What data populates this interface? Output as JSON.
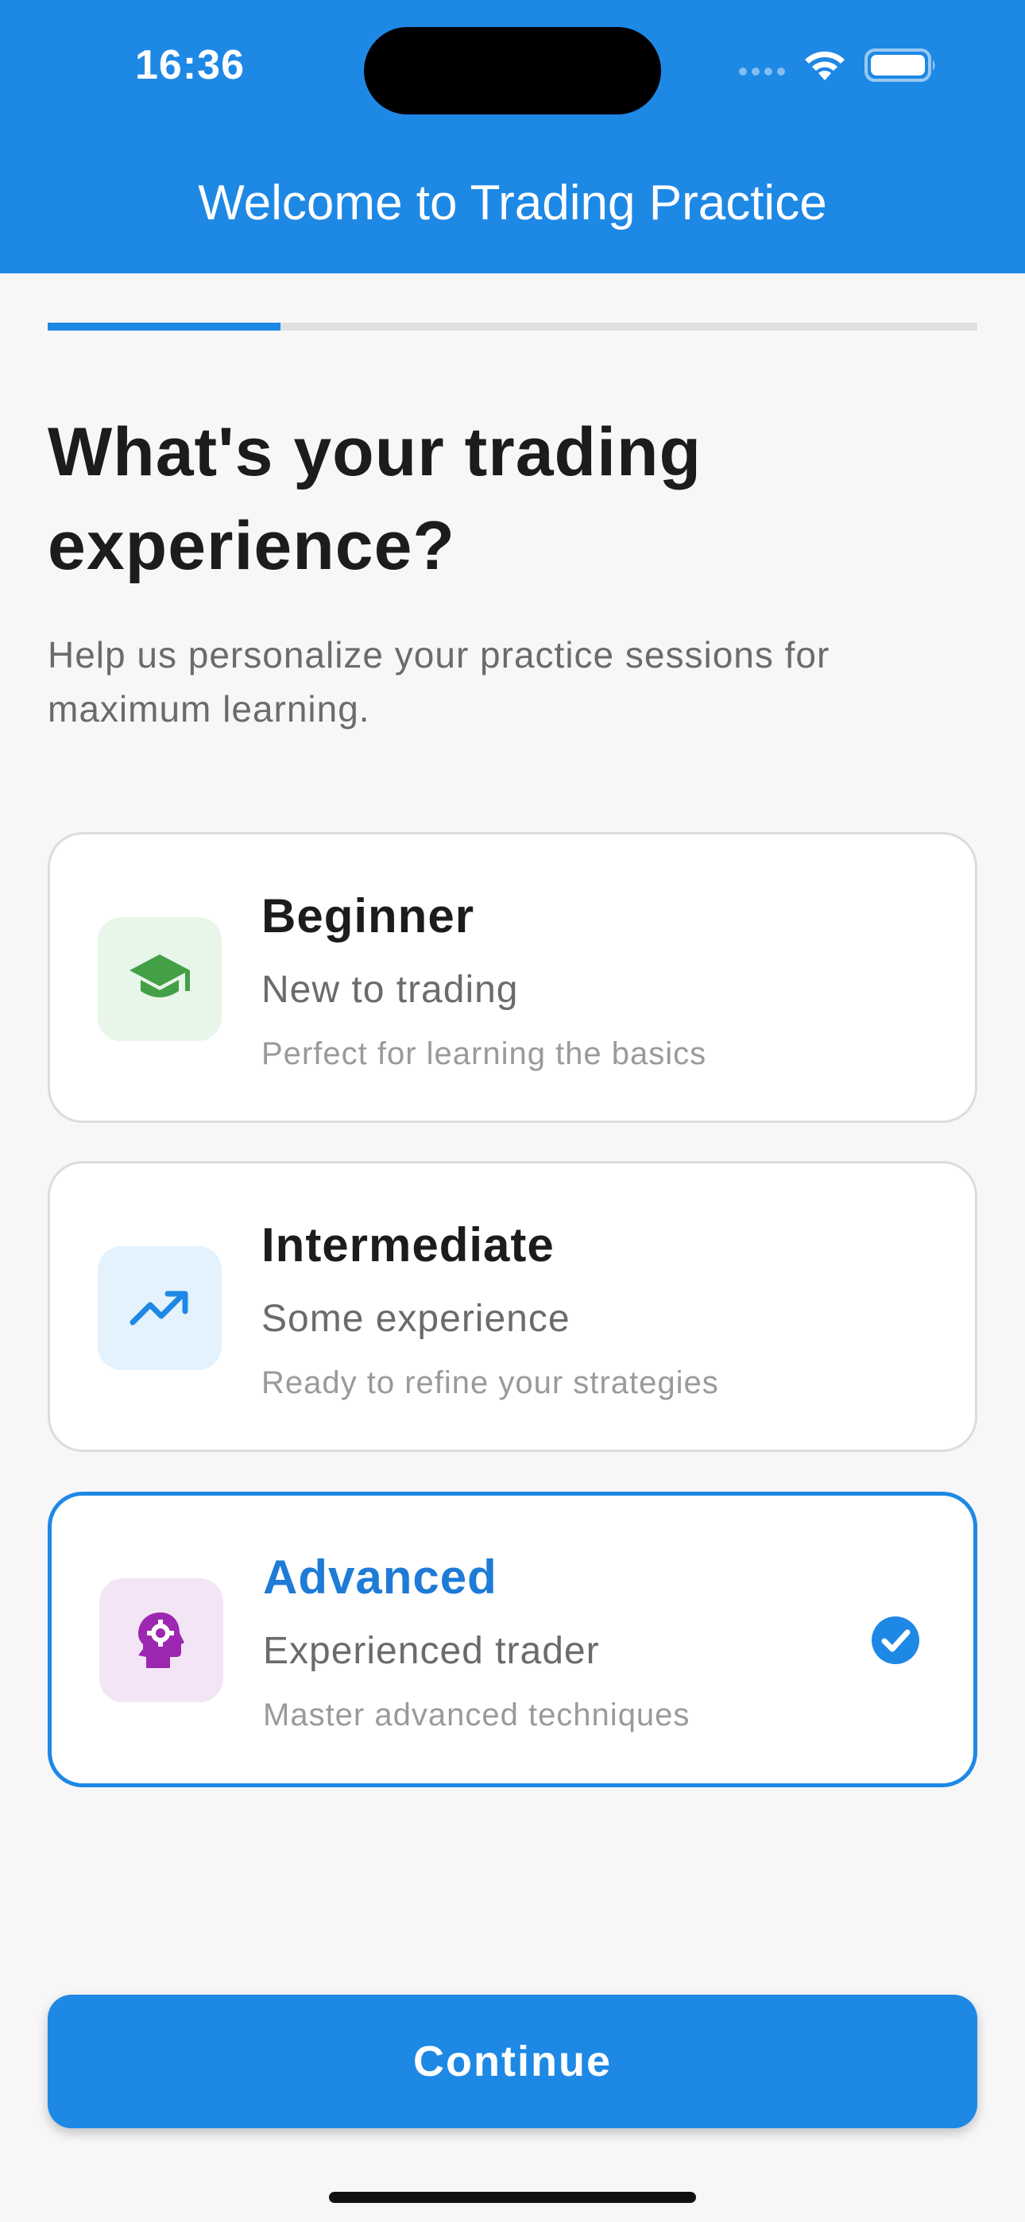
{
  "status_bar": {
    "time": "16:36"
  },
  "header": {
    "title": "Welcome to Trading Practice"
  },
  "progress": {
    "fraction": 0.25
  },
  "question": {
    "title": "What's your trading experience?",
    "subtitle": "Help us personalize your practice sessions for maximum learning."
  },
  "options": [
    {
      "title": "Beginner",
      "subtitle": "New to trading",
      "description": "Perfect for learning the basics",
      "icon": "graduation-cap-icon",
      "icon_color": "#43a047",
      "icon_bg": "#e8f5e9",
      "selected": false
    },
    {
      "title": "Intermediate",
      "subtitle": "Some experience",
      "description": "Ready to refine your strategies",
      "icon": "trending-up-icon",
      "icon_color": "#1e88e5",
      "icon_bg": "#e3f2fd",
      "selected": false
    },
    {
      "title": "Advanced",
      "subtitle": "Experienced trader",
      "description": "Master advanced techniques",
      "icon": "psychology-head-icon",
      "icon_color": "#9c27b0",
      "icon_bg": "#f3e5f5",
      "selected": true
    }
  ],
  "continue_button": {
    "label": "Continue"
  },
  "colors": {
    "accent": "#1e88e5"
  }
}
